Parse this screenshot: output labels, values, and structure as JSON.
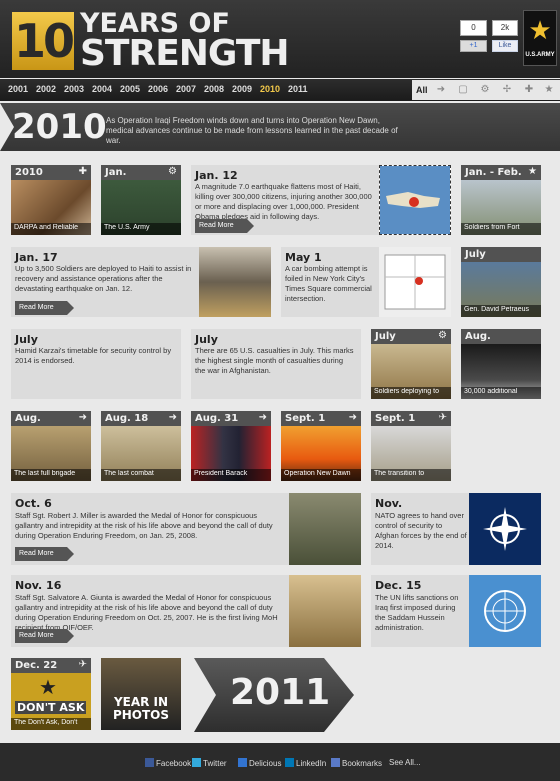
{
  "header": {
    "logo_number": "10",
    "title_line1": "YEARS OF",
    "title_line2": "STRENGTH",
    "gplus_count": "0",
    "gplus_label": "+1",
    "like_count": "2k",
    "like_label": "Like",
    "army_text": "U.S.ARMY"
  },
  "years": [
    "2001",
    "2002",
    "2003",
    "2004",
    "2005",
    "2006",
    "2007",
    "2008",
    "2009",
    "2010",
    "2011"
  ],
  "active_year": "2010",
  "filter": {
    "all_label": "All"
  },
  "banner": {
    "year": "2010",
    "text": "As Operation Iraqi Freedom winds down and turns into Operation New Dawn, medical advances continue to be made from lessons learned in the past decade of war."
  },
  "cards": {
    "c2010": {
      "label": "2010",
      "caption": "DARPA and Reliable"
    },
    "jan": {
      "label": "Jan.",
      "caption": "The U.S. Army"
    },
    "jan12": {
      "title": "Jan. 12",
      "body": "A magnitude 7.0 earthquake flattens most of Haiti, killing over 300,000 citizens, injuring another 300,000 or more and displacing over 1,000,000. President Obama pledges aid in following days.",
      "read_more": "Read More"
    },
    "janfeb": {
      "label": "Jan. - Feb.",
      "caption": "Soldiers from Fort"
    },
    "jan17": {
      "title": "Jan. 17",
      "body": "Up to 3,500 Soldiers are deployed to Haiti to assist in recovery and assistance operations after the devastating earthquake on Jan. 12.",
      "read_more": "Read More"
    },
    "may1": {
      "title": "May 1",
      "body": "A car bombing attempt is foiled in New York City's Times Square commercial intersection."
    },
    "july_pet": {
      "label": "July",
      "caption": "Gen. David Petraeus"
    },
    "july_karzai": {
      "title": "July",
      "body": "Hamid Karzai's timetable for security control by 2014 is endorsed."
    },
    "july_cas": {
      "title": "July",
      "body": "There are 65 U.S. casualties in July. This marks the highest single month of casualties during the war in Afghanistan."
    },
    "july_sol": {
      "label": "July",
      "caption": "Soldiers deploying to"
    },
    "aug_30k": {
      "label": "Aug.",
      "caption": "30,000 additional"
    },
    "aug_brig": {
      "label": "Aug.",
      "caption": "The last full brigade"
    },
    "aug18": {
      "label": "Aug. 18",
      "caption": "The last combat"
    },
    "aug31": {
      "label": "Aug. 31",
      "caption": "President Barack"
    },
    "sept1_nd": {
      "label": "Sept. 1",
      "caption": "Operation New Dawn"
    },
    "sept1_tr": {
      "label": "Sept. 1",
      "caption": "The transition to"
    },
    "oct6": {
      "title": "Oct. 6",
      "body": "Staff Sgt. Robert J. Miller is awarded the Medal of Honor for conspicuous gallantry and intrepidity at the risk of his life above and beyond the call of duty during Operation Enduring Freedom, on Jan. 25, 2008.",
      "read_more": "Read More"
    },
    "nov": {
      "title": "Nov.",
      "body": "NATO agrees to hand over control of security to Afghan forces by the end of 2014."
    },
    "nov16": {
      "title": "Nov. 16",
      "body": "Staff Sgt. Salvatore A. Giunta is awarded the Medal of Honor for conspicuous gallantry and intrepidity at the risk of his life above and beyond the call of duty during Operation Enduring Freedom on Oct. 25, 2007. He is the first living MoH recipient from OIF/OEF.",
      "read_more": "Read More"
    },
    "dec15": {
      "title": "Dec. 15",
      "body": "The UN lifts sanctions on Iraq first imposed during the Saddam Hussein administration."
    },
    "dec22": {
      "label": "Dec. 22",
      "caption": "The Don't Ask, Don't",
      "image_text": "DON'T ASK"
    },
    "photos": {
      "line1": "YEAR IN",
      "line2": "PHOTOS"
    }
  },
  "next_year": "2011",
  "footer": {
    "links": [
      "Facebook",
      "Twitter",
      "Delicious",
      "LinkedIn",
      "Bookmarks",
      "See All..."
    ]
  },
  "colors": {
    "accent": "#f3c94a",
    "header_bg": "#2b2b2b",
    "card_bg": "#d9d9d9"
  },
  "icons": [
    "plus-icon",
    "gear-icon",
    "star-icon",
    "arrow-right-icon",
    "helicopter-icon",
    "plane-icon",
    "square-icon"
  ]
}
